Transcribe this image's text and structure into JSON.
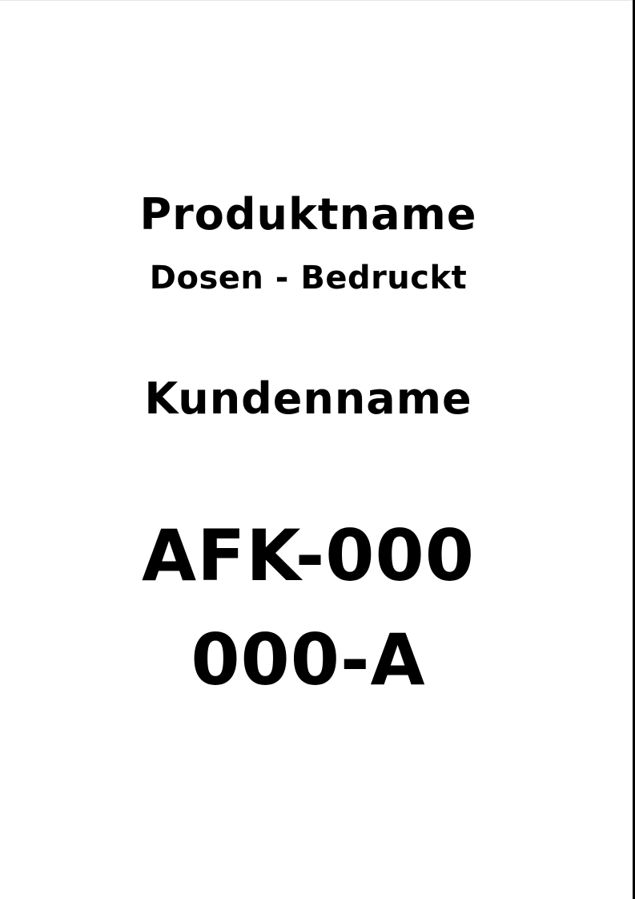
{
  "document": {
    "product_name": "Produktname",
    "product_variant": "Dosen - Bedruckt",
    "customer_name": "Kundenname",
    "order_number_line1": "AFK-000",
    "order_number_line2": "000-A"
  },
  "colors": {
    "text": "#000000",
    "background": "#ffffff"
  }
}
